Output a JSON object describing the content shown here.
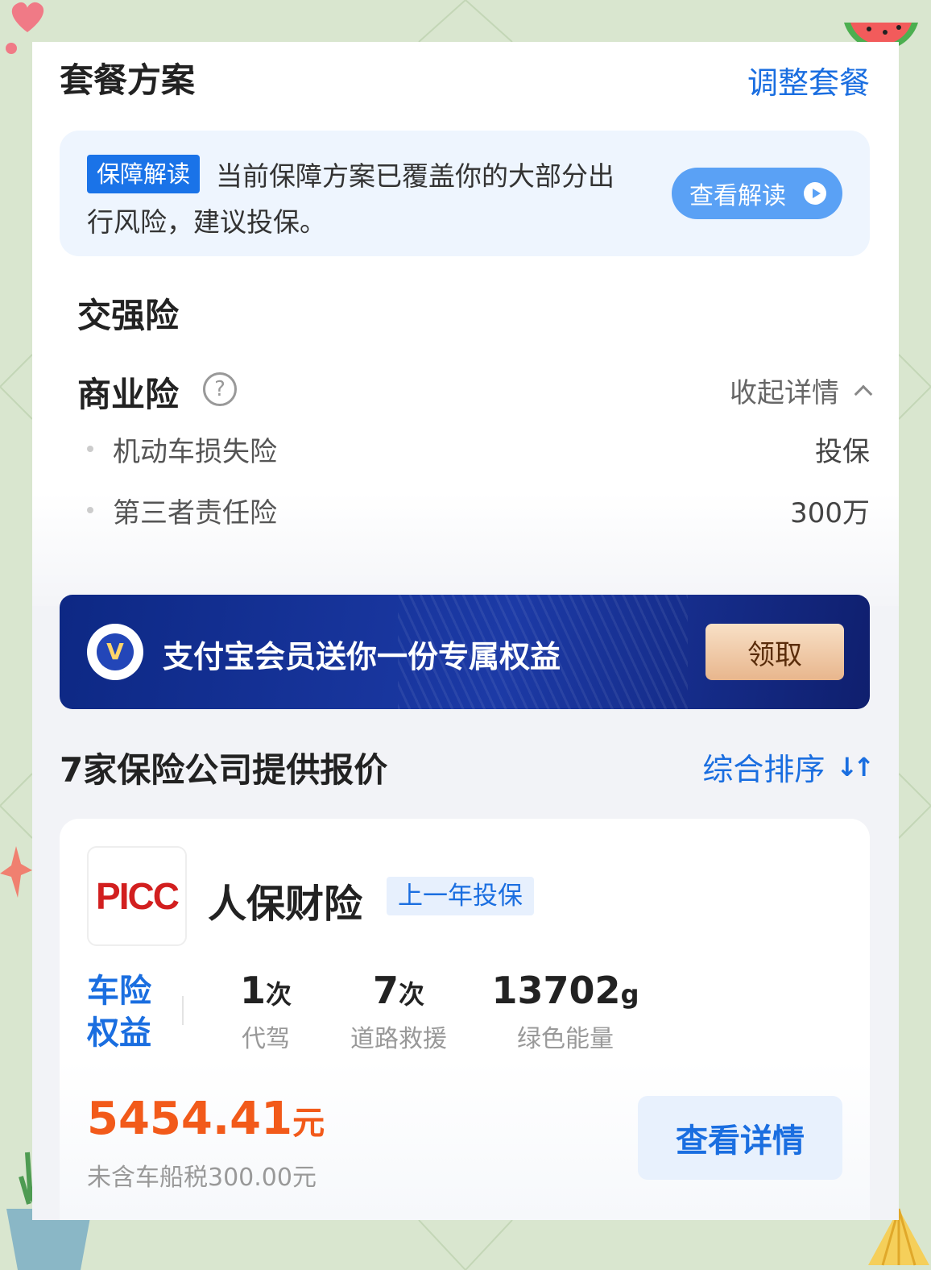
{
  "plan": {
    "title": "套餐方案",
    "adjust_label": "调整套餐"
  },
  "notice": {
    "badge": "保障解读",
    "text": "当前保障方案已覆盖你的大部分出行风险，建议投保。",
    "button_label": "查看解读"
  },
  "compulsory": {
    "title": "交强险"
  },
  "commercial": {
    "title": "商业险",
    "collapse_label": "收起详情",
    "items": [
      {
        "name": "机动车损失险",
        "value": "投保"
      },
      {
        "name": "第三者责任险",
        "value": "300万"
      }
    ]
  },
  "banner": {
    "text": "支付宝会员送你一份专属权益",
    "button_label": "领取"
  },
  "quotes": {
    "title": "7家保险公司提供报价",
    "sort_label": "综合排序"
  },
  "company": {
    "logo_text": "PICC",
    "name": "人保财险",
    "tag": "上一年投保",
    "perk_label_line1": "车险",
    "perk_label_line2": "权益",
    "stats": [
      {
        "value": "1",
        "unit": "次",
        "label": "代驾"
      },
      {
        "value": "7",
        "unit": "次",
        "label": "道路救援"
      },
      {
        "value": "13702",
        "unit": "g",
        "label": "绿色能量"
      }
    ],
    "price": "5454.41",
    "price_unit": "元",
    "tax_note": "未含车船税300.00元",
    "detail_button": "查看详情"
  },
  "colors": {
    "accent": "#1a6ee0",
    "price": "#f25a1a",
    "banner": "#0d2884",
    "background": "#d9e6cf"
  }
}
